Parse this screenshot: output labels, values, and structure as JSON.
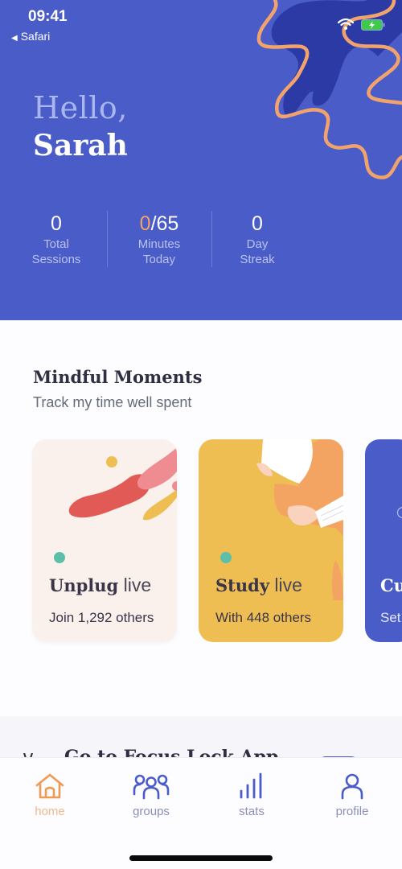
{
  "status_bar": {
    "time": "09:41",
    "back_app": "Safari",
    "wifi_icon": "wifi-icon",
    "battery_icon": "battery-charging-icon"
  },
  "greeting": {
    "hello": "Hello,",
    "name": "Sarah"
  },
  "stats": [
    {
      "value": "0",
      "label_line1": "Total",
      "label_line2": "Sessions"
    },
    {
      "value_current": "0",
      "value_total": "/65",
      "label_line1": "Minutes",
      "label_line2": "Today"
    },
    {
      "value": "0",
      "label_line1": "Day",
      "label_line2": "Streak"
    }
  ],
  "section": {
    "title": "Mindful Moments",
    "subtitle": "Track my time well spent"
  },
  "cards": [
    {
      "title": "Unplug",
      "status": "live",
      "subtitle": "Join 1,292 others"
    },
    {
      "title": "Study",
      "status": "live",
      "subtitle": "With 448 others"
    },
    {
      "title": "Cu",
      "subtitle": "Set"
    }
  ],
  "focus_link": {
    "label": "Go to Focus Lock App"
  },
  "tabs": [
    {
      "label": "home",
      "icon": "home-icon",
      "active": true
    },
    {
      "label": "groups",
      "icon": "groups-icon",
      "active": false
    },
    {
      "label": "stats",
      "icon": "stats-icon",
      "active": false
    },
    {
      "label": "profile",
      "icon": "profile-icon",
      "active": false
    }
  ],
  "colors": {
    "primary": "#4a5cc8",
    "accent": "#f3a06a",
    "live_dot": "#5bbfaa",
    "study_card": "#efbe52",
    "unplug_card": "#fbf1ec"
  }
}
